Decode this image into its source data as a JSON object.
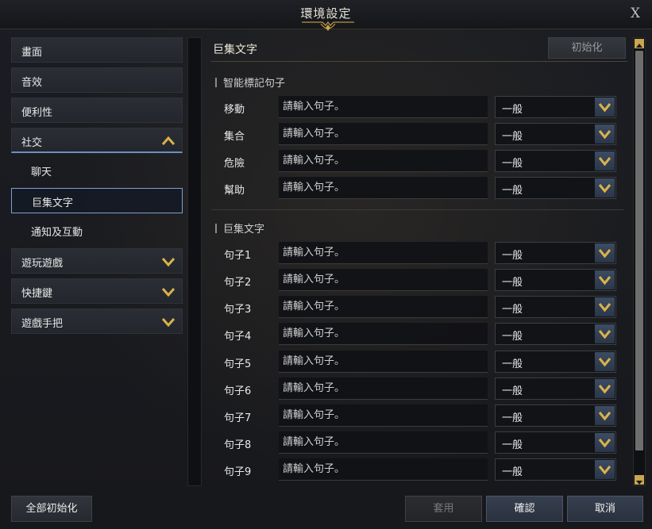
{
  "window": {
    "title": "環境設定",
    "close_label": "X"
  },
  "sidebar": {
    "items": [
      {
        "label": "畫面"
      },
      {
        "label": "音效"
      },
      {
        "label": "便利性"
      },
      {
        "label": "社交",
        "expanded": true
      },
      {
        "label": "聊天",
        "sub": true
      },
      {
        "label": "巨集文字",
        "sub": true,
        "selected": true
      },
      {
        "label": "通知及互動",
        "sub": true
      },
      {
        "label": "遊玩遊戲"
      },
      {
        "label": "快捷鍵"
      },
      {
        "label": "遊戲手把"
      }
    ]
  },
  "main": {
    "title": "巨集文字",
    "reset_label": "初始化",
    "smart_section": {
      "title": "智能標記句子",
      "rows": [
        {
          "label": "移動",
          "placeholder": "請輸入句子。",
          "select": "一般"
        },
        {
          "label": "集合",
          "placeholder": "請輸入句子。",
          "select": "一般"
        },
        {
          "label": "危險",
          "placeholder": "請輸入句子。",
          "select": "一般"
        },
        {
          "label": "幫助",
          "placeholder": "請輸入句子。",
          "select": "一般"
        }
      ]
    },
    "macro_section": {
      "title": "巨集文字",
      "rows": [
        {
          "label": "句子1",
          "placeholder": "請輸入句子。",
          "select": "一般"
        },
        {
          "label": "句子2",
          "placeholder": "請輸入句子。",
          "select": "一般"
        },
        {
          "label": "句子3",
          "placeholder": "請輸入句子。",
          "select": "一般"
        },
        {
          "label": "句子4",
          "placeholder": "請輸入句子。",
          "select": "一般"
        },
        {
          "label": "句子5",
          "placeholder": "請輸入句子。",
          "select": "一般"
        },
        {
          "label": "句子6",
          "placeholder": "請輸入句子。",
          "select": "一般"
        },
        {
          "label": "句子7",
          "placeholder": "請輸入句子。",
          "select": "一般"
        },
        {
          "label": "句子8",
          "placeholder": "請輸入句子。",
          "select": "一般"
        },
        {
          "label": "句子9",
          "placeholder": "請輸入句子。",
          "select": "一般"
        }
      ]
    }
  },
  "footer": {
    "reset_all_label": "全部初始化",
    "apply_label": "套用",
    "confirm_label": "確認",
    "cancel_label": "取消"
  },
  "colors": {
    "accent_gold": "#c9a64f",
    "selected_border": "#7f9fd0",
    "dropdown_button": "#3c4c63"
  },
  "icons": {
    "chevron_down": "chevron-down-icon",
    "chevron_up": "chevron-up-icon",
    "close": "close-icon"
  }
}
